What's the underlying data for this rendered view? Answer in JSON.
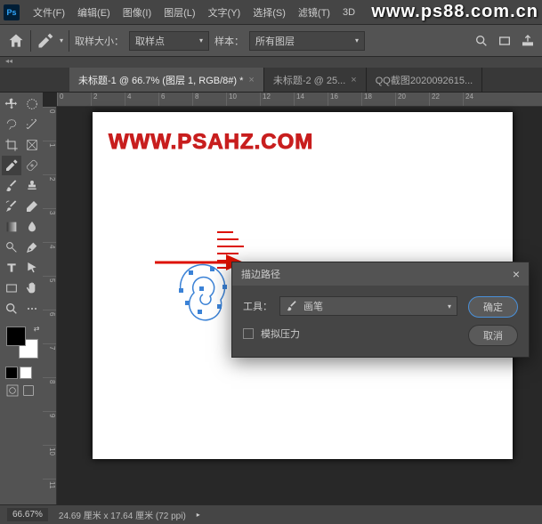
{
  "menubar": {
    "items": [
      "文件(F)",
      "编辑(E)",
      "图像(I)",
      "图层(L)",
      "文字(Y)",
      "选择(S)",
      "滤镜(T)",
      "3D"
    ]
  },
  "watermark": "www.ps88.com.cn",
  "optionbar": {
    "sample_size_label": "取样大小：",
    "sample_size_value": "取样点",
    "sample_label": "样本：",
    "sample_value": "所有图层"
  },
  "tabs": [
    {
      "label": "未标题-1 @ 66.7% (图层 1, RGB/8#) *",
      "active": true
    },
    {
      "label": "未标题-2 @ 25...",
      "active": false
    },
    {
      "label": "QQ截图2020092615...",
      "active": false
    }
  ],
  "ruler_h": [
    "0",
    "2",
    "4",
    "6",
    "8",
    "10",
    "12",
    "14",
    "16",
    "18",
    "20",
    "22",
    "24"
  ],
  "ruler_v": [
    "0",
    "1",
    "2",
    "3",
    "4",
    "5",
    "6",
    "7",
    "8",
    "9",
    "10",
    "11"
  ],
  "canvas": {
    "text": "WWW.PSAHZ.COM"
  },
  "dialog": {
    "title": "描边路径",
    "tool_label": "工具：",
    "tool_value": "画笔",
    "pressure_label": "模拟压力",
    "ok": "确定",
    "cancel": "取消"
  },
  "statusbar": {
    "zoom": "66.67%",
    "doc": "24.69 厘米 x 17.64 厘米 (72 ppi)"
  }
}
